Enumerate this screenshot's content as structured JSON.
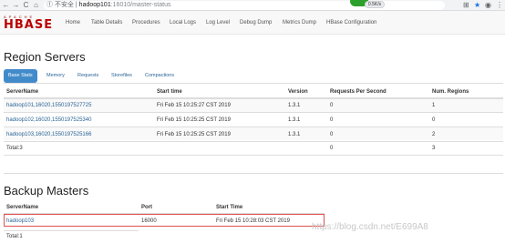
{
  "browser": {
    "back_icon": "←",
    "forward_icon": "→",
    "reload_icon": "C",
    "home_icon": "⌂",
    "secure_label": "① 不安全 |",
    "url_host": "hadoop101",
    "url_path": ":16010/master-status",
    "ext_label": "0.5K/s",
    "ext_color": "#2ca02c"
  },
  "navbar": {
    "logo_top": "APACHE",
    "logo_main": "HBASE",
    "links": [
      "Home",
      "Table Details",
      "Procedures",
      "Local Logs",
      "Log Level",
      "Debug Dump",
      "Metrics Dump",
      "HBase Configuration"
    ]
  },
  "region_servers": {
    "title": "Region Servers",
    "tabs": [
      "Base Stats",
      "Memory",
      "Requests",
      "Storefiles",
      "Compactions"
    ],
    "headers": [
      "ServerName",
      "Start time",
      "Version",
      "Requests Per Second",
      "Num. Regions"
    ],
    "rows": [
      [
        "hadoop101,16020,1550197527725",
        "Fri Feb 15 10:25:27 CST 2019",
        "1.3.1",
        "0",
        "1"
      ],
      [
        "hadoop102,16020,1550197525340",
        "Fri Feb 15 10:25:25 CST 2019",
        "1.3.1",
        "0",
        "0"
      ],
      [
        "hadoop103,16020,1550197525166",
        "Fri Feb 15 10:25:25 CST 2019",
        "1.3.1",
        "0",
        "2"
      ]
    ],
    "total": [
      "Total:3",
      "0",
      "3"
    ]
  },
  "backup_masters": {
    "title": "Backup Masters",
    "headers": [
      "ServerName",
      "Port",
      "Start Time"
    ],
    "rows": [
      [
        "hadoop103",
        "16000",
        "Fri Feb 15 10:28:03 CST 2019"
      ]
    ],
    "total": "Total:1"
  },
  "watermark": "https://blog.csdn.net/E699A8"
}
